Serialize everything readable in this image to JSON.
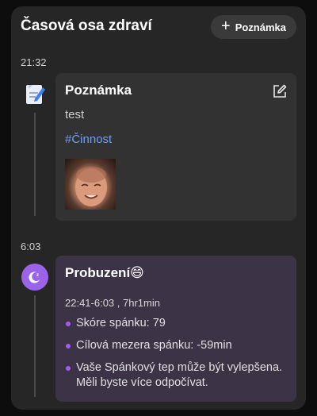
{
  "header": {
    "title": "Časová osa zdraví",
    "add_label": "Poznámka"
  },
  "entries": [
    {
      "time": "21:32",
      "title": "Poznámka",
      "text": "test",
      "tag": "#Činnost"
    },
    {
      "time": "6:03",
      "title": "Probuzení😄",
      "range": "22:41-6:03 , 7hr1min",
      "bullets": [
        "Skóre spánku: 79",
        "Cílová mezera spánku: -59min",
        "Vaše Spánkový tep může být vylepšena. Měli byste více odpočívat."
      ]
    }
  ],
  "colors": {
    "accent_purple": "#9b63e8",
    "link_blue": "#6f9ff0"
  },
  "icons": [
    "plus-icon",
    "note-icon",
    "edit-icon",
    "sleep-moon-icon"
  ]
}
